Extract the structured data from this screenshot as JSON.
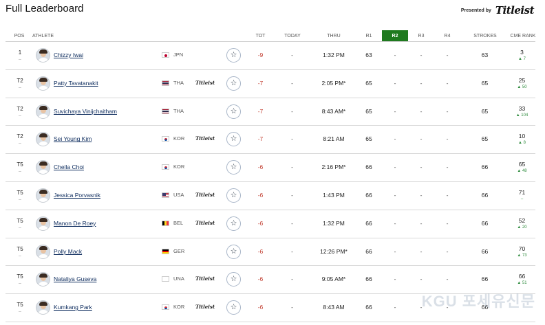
{
  "page": {
    "title": "Full Leaderboard",
    "sponsor_text": "Presented by",
    "sponsor_logo": "Titleist"
  },
  "columns": {
    "pos": "POS",
    "athlete": "ATHLETE",
    "tot": "TOT",
    "today": "TODAY",
    "thru": "THRU",
    "r1": "R1",
    "r2": "R2",
    "r3": "R3",
    "r4": "R4",
    "strokes": "STROKES",
    "cme": "CME RANK"
  },
  "colors": {
    "active_round": "#1f7a1f",
    "score_under_par": "#c0392b",
    "rank_up": "#2e8b3d",
    "link": "#0b2a5c"
  },
  "rows": [
    {
      "pos": "1",
      "pos_move": "–",
      "name": "Chizzy Iwai",
      "country": "JPN",
      "flag": "japan",
      "titleist": "",
      "tot": "-9",
      "today": "-",
      "thru": "1:32 PM",
      "r1": "63",
      "r2": "-",
      "r3": "-",
      "r4": "-",
      "strokes": "63",
      "cme": "3",
      "cme_move": "▲ 7"
    },
    {
      "pos": "T2",
      "pos_move": "–",
      "name": "Patty Tavatanakit",
      "country": "THA",
      "flag": "thailand",
      "titleist": "Titleist",
      "tot": "-7",
      "today": "-",
      "thru": "2:05 PM*",
      "r1": "65",
      "r2": "-",
      "r3": "-",
      "r4": "-",
      "strokes": "65",
      "cme": "25",
      "cme_move": "▲ 50"
    },
    {
      "pos": "T2",
      "pos_move": "–",
      "name": "Suvichaya Vinijchaitham",
      "country": "THA",
      "flag": "thailand",
      "titleist": "",
      "tot": "-7",
      "today": "-",
      "thru": "8:43 AM*",
      "r1": "65",
      "r2": "-",
      "r3": "-",
      "r4": "-",
      "strokes": "65",
      "cme": "33",
      "cme_move": "▲ 104"
    },
    {
      "pos": "T2",
      "pos_move": "–",
      "name": "Sei Young Kim",
      "country": "KOR",
      "flag": "korea",
      "titleist": "Titleist",
      "tot": "-7",
      "today": "-",
      "thru": "8:21 AM",
      "r1": "65",
      "r2": "-",
      "r3": "-",
      "r4": "-",
      "strokes": "65",
      "cme": "10",
      "cme_move": "▲ 8"
    },
    {
      "pos": "T5",
      "pos_move": "–",
      "name": "Chella Choi",
      "country": "KOR",
      "flag": "korea",
      "titleist": "",
      "tot": "-6",
      "today": "-",
      "thru": "2:16 PM*",
      "r1": "66",
      "r2": "-",
      "r3": "-",
      "r4": "-",
      "strokes": "66",
      "cme": "65",
      "cme_move": "▲ 48"
    },
    {
      "pos": "T5",
      "pos_move": "–",
      "name": "Jessica Porvasnik",
      "country": "USA",
      "flag": "usa",
      "titleist": "Titleist",
      "tot": "-6",
      "today": "-",
      "thru": "1:43 PM",
      "r1": "66",
      "r2": "-",
      "r3": "-",
      "r4": "-",
      "strokes": "66",
      "cme": "71",
      "cme_move": "–"
    },
    {
      "pos": "T5",
      "pos_move": "–",
      "name": "Manon De Roey",
      "country": "BEL",
      "flag": "belgium",
      "titleist": "Titleist",
      "tot": "-6",
      "today": "-",
      "thru": "1:32 PM",
      "r1": "66",
      "r2": "-",
      "r3": "-",
      "r4": "-",
      "strokes": "66",
      "cme": "52",
      "cme_move": "▲ 20"
    },
    {
      "pos": "T5",
      "pos_move": "–",
      "name": "Polly Mack",
      "country": "GER",
      "flag": "germany",
      "titleist": "",
      "tot": "-6",
      "today": "-",
      "thru": "12:26 PM*",
      "r1": "66",
      "r2": "-",
      "r3": "-",
      "r4": "-",
      "strokes": "66",
      "cme": "70",
      "cme_move": "▲ 73"
    },
    {
      "pos": "T5",
      "pos_move": "–",
      "name": "Nataliya Guseva",
      "country": "UNA",
      "flag": "blank",
      "titleist": "Titleist",
      "tot": "-6",
      "today": "-",
      "thru": "9:05 AM*",
      "r1": "66",
      "r2": "-",
      "r3": "-",
      "r4": "-",
      "strokes": "66",
      "cme": "66",
      "cme_move": "▲ 51"
    },
    {
      "pos": "T5",
      "pos_move": "–",
      "name": "Kumkang Park",
      "country": "KOR",
      "flag": "korea",
      "titleist": "Titleist",
      "tot": "-6",
      "today": "-",
      "thru": "8:43 AM",
      "r1": "66",
      "r2": "-",
      "r3": "-",
      "r4": "-",
      "strokes": "66",
      "cme": "",
      "cme_move": ""
    }
  ],
  "watermark": "KGU 포세유신문"
}
